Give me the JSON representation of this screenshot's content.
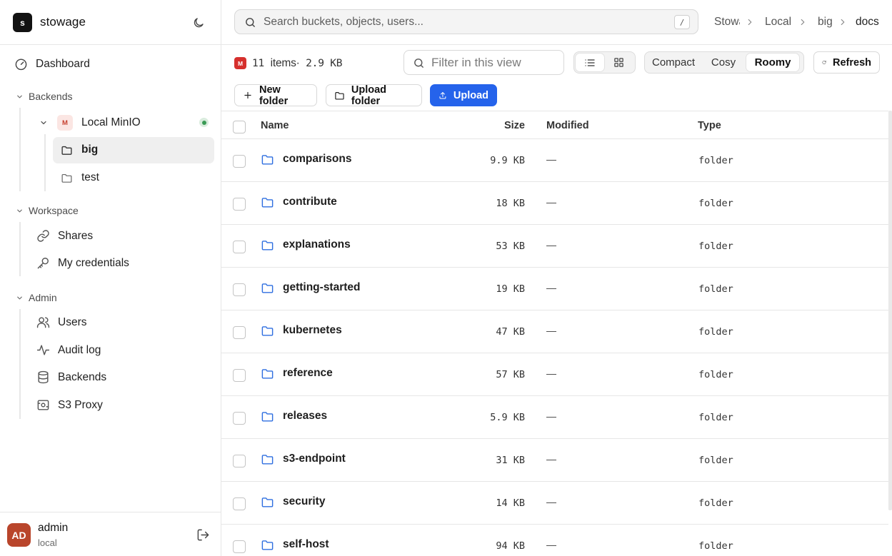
{
  "app": {
    "name": "stowage",
    "logo_letter": "s"
  },
  "sidebar": {
    "dashboard": "Dashboard",
    "sections": {
      "backends": "Backends",
      "workspace": "Workspace",
      "admin": "Admin"
    },
    "backend": {
      "name": "Local MinIO",
      "badge": "M",
      "status_color": "#3a9a55"
    },
    "buckets": [
      {
        "label": "big",
        "active": true
      },
      {
        "label": "test",
        "active": false
      }
    ],
    "workspace_items": [
      {
        "label": "Shares",
        "icon": "link-icon"
      },
      {
        "label": "My credentials",
        "icon": "key-icon"
      }
    ],
    "admin_items": [
      {
        "label": "Users",
        "icon": "users-icon"
      },
      {
        "label": "Audit log",
        "icon": "activity-icon"
      },
      {
        "label": "Backends",
        "icon": "database-icon"
      },
      {
        "label": "S3 Proxy",
        "icon": "proxy-icon"
      }
    ],
    "user": {
      "initials": "AD",
      "name": "admin",
      "role": "local"
    }
  },
  "topbar": {
    "search_placeholder": "Search buckets, objects, users...",
    "shortcut": "/",
    "breadcrumbs": [
      "Stowage",
      "Local MinIO",
      "big",
      "docs"
    ]
  },
  "toolbar": {
    "badge": "M",
    "item_count": "11",
    "items_label": "items",
    "total_size": "2.9 KB",
    "filter_placeholder": "Filter in this view",
    "view_modes": [
      "list-icon",
      "grid-icon"
    ],
    "density": {
      "options": [
        "Compact",
        "Cosy",
        "Roomy"
      ],
      "selected": "Roomy"
    },
    "refresh": "Refresh",
    "new_folder": "New folder",
    "upload_folder": "Upload folder",
    "upload": "Upload"
  },
  "table": {
    "columns": {
      "name": "Name",
      "size": "Size",
      "modified": "Modified",
      "type": "Type"
    },
    "rows": [
      {
        "name": "comparisons",
        "size": "9.9 KB",
        "modified": "—",
        "type": "folder"
      },
      {
        "name": "contribute",
        "size": "18 KB",
        "modified": "—",
        "type": "folder"
      },
      {
        "name": "explanations",
        "size": "53 KB",
        "modified": "—",
        "type": "folder"
      },
      {
        "name": "getting-started",
        "size": "19 KB",
        "modified": "—",
        "type": "folder"
      },
      {
        "name": "kubernetes",
        "size": "47 KB",
        "modified": "—",
        "type": "folder"
      },
      {
        "name": "reference",
        "size": "57 KB",
        "modified": "—",
        "type": "folder"
      },
      {
        "name": "releases",
        "size": "5.9 KB",
        "modified": "—",
        "type": "folder"
      },
      {
        "name": "s3-endpoint",
        "size": "31 KB",
        "modified": "—",
        "type": "folder"
      },
      {
        "name": "security",
        "size": "14 KB",
        "modified": "—",
        "type": "folder"
      },
      {
        "name": "self-host",
        "size": "94 KB",
        "modified": "—",
        "type": "folder"
      }
    ]
  },
  "colors": {
    "accent": "#2563eb",
    "folder_icon": "#2f6fe0",
    "badge_red": "#d6302d",
    "avatar": "#b9452b"
  }
}
